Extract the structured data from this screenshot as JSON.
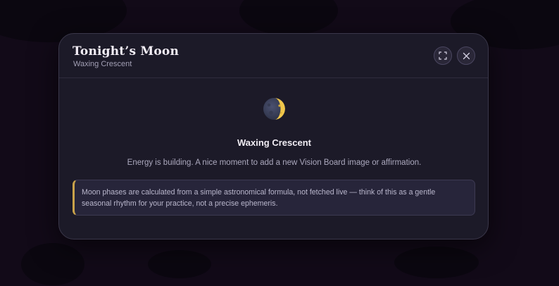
{
  "modal": {
    "title": "Tonight’s Moon",
    "subtitle": "Waxing Crescent",
    "expand_icon": "expand-icon",
    "close_icon": "close-icon"
  },
  "moon": {
    "icon": "waxing-crescent-moon-icon",
    "phase_name": "Waxing Crescent",
    "description": "Energy is building. A nice moment to add a new Vision Board image or affirmation.",
    "note": "Moon phases are calculated from a simple astronomical formula, not fetched live — think of this as a gentle seasonal rhythm for your practice, not a precise ephemeris."
  },
  "colors": {
    "backdrop": "#120a18",
    "modal_bg": "#1c1a28",
    "accent_gold": "#c9a24a",
    "moon_lit": "#f0c64a",
    "moon_dark": "#3b4158"
  }
}
